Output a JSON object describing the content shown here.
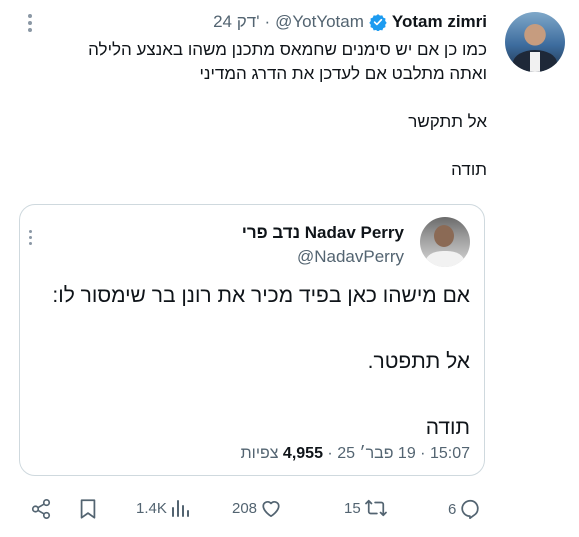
{
  "tweet": {
    "author_name": "Yotam zimri",
    "handle": "@YotYotam",
    "time": "24 דק'",
    "lines": [
      "כמו כן אם יש סימנים שחמאס מתכנן משהו באנצע הלילה",
      "ואתה מתלבט אם לעדכן את הדרג המדיני",
      "",
      "אל תתקשר",
      "",
      "תודה"
    ]
  },
  "quote": {
    "author_name": "נדב פרי Nadav Perry",
    "handle": "@NadavPerry",
    "lines": [
      "אם מישהו כאן בפיד מכיר את רונן בר שימסור לו:",
      "",
      "אל תתפטר.",
      "",
      "תודה"
    ],
    "time": "15:07",
    "date": "19 פבר׳ 25",
    "views_count": "4,955",
    "views_label": "צפיות"
  },
  "actions": {
    "replies": "6",
    "reposts": "15",
    "likes": "208",
    "views": "1.4K"
  },
  "colors": {
    "text": "#0f1419",
    "secondary": "#536471",
    "verified": "#1d9bf0",
    "border": "#cfd9de"
  }
}
